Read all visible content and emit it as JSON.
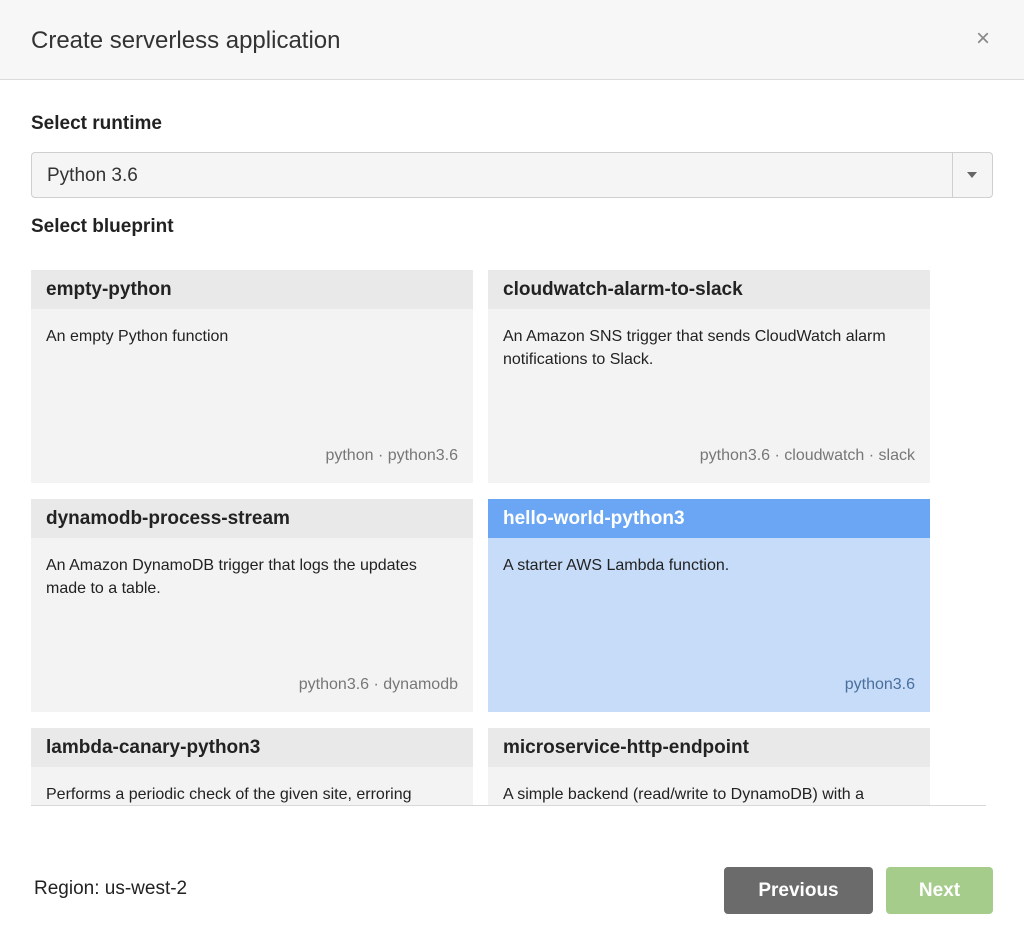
{
  "dialog": {
    "title": "Create serverless application",
    "close_label": "×"
  },
  "runtime": {
    "label": "Select runtime",
    "selected": "Python 3.6"
  },
  "blueprint": {
    "label": "Select blueprint",
    "cards": [
      {
        "title": "empty-python",
        "description": "An empty Python function",
        "tags": "python · python3.6",
        "selected": false
      },
      {
        "title": "cloudwatch-alarm-to-slack",
        "description": "An Amazon SNS trigger that sends CloudWatch alarm notifications to Slack.",
        "tags": "python3.6 · cloudwatch · slack",
        "selected": false
      },
      {
        "title": "dynamodb-process-stream",
        "description": "An Amazon DynamoDB trigger that logs the updates made to a table.",
        "tags": "python3.6 · dynamodb",
        "selected": false
      },
      {
        "title": "hello-world-python3",
        "description": "A starter AWS Lambda function.",
        "tags": "python3.6",
        "selected": true
      },
      {
        "title": "lambda-canary-python3",
        "description": "Performs a periodic check of the given site, erroring",
        "tags": "",
        "selected": false
      },
      {
        "title": "microservice-http-endpoint",
        "description": "A simple backend (read/write to DynamoDB) with a",
        "tags": "",
        "selected": false
      }
    ]
  },
  "footer": {
    "region": "Region: us-west-2",
    "previous_label": "Previous",
    "next_label": "Next"
  },
  "colors": {
    "selected_card_header": "#6aa6f3",
    "selected_card_body": "#c6dcf9",
    "previous_button": "#6b6b6b",
    "next_button": "#a6cc8c"
  }
}
